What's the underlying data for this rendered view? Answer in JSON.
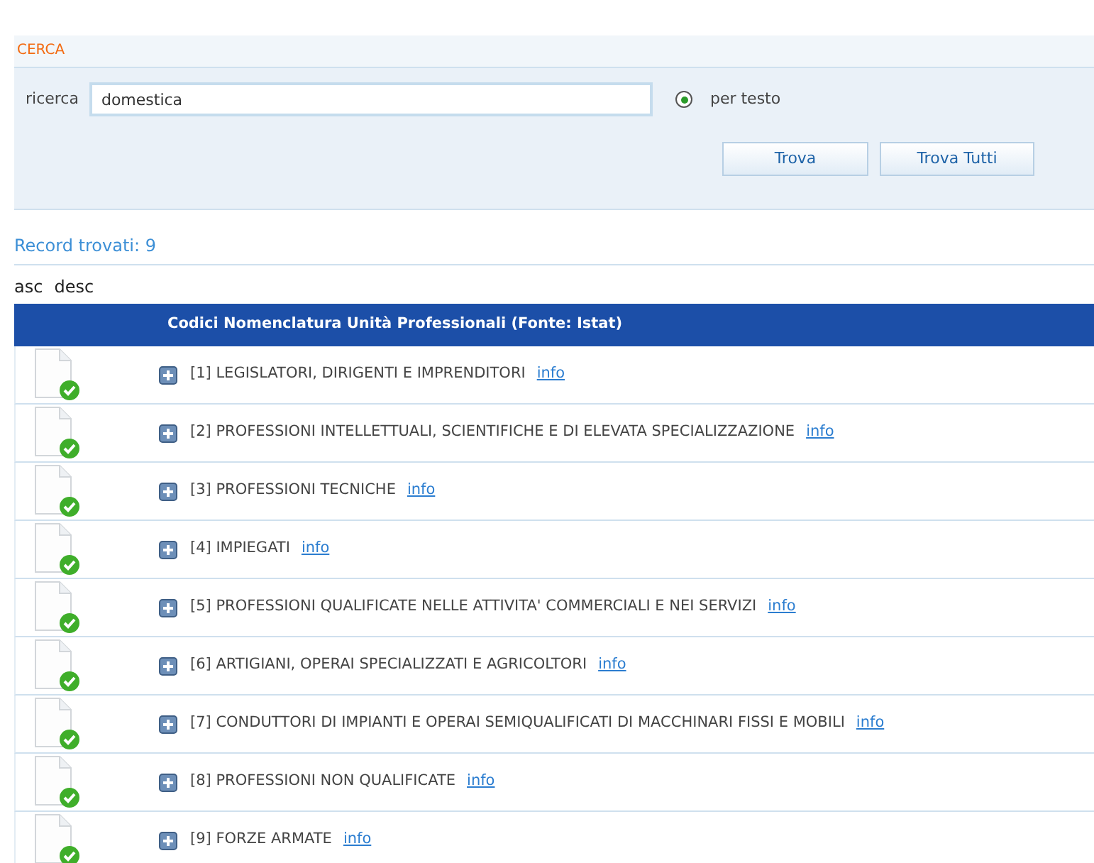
{
  "search_panel": {
    "title": "CERCA",
    "field_label": "ricerca",
    "query": "domestica",
    "modes": [
      {
        "label": "per testo",
        "selected": true
      }
    ],
    "buttons": [
      "Trova",
      "Trova Tutti"
    ]
  },
  "result_count": "Record trovati: 9",
  "sort_links": [
    "asc",
    "desc"
  ],
  "table": {
    "header": "Codici Nomenclatura Unità Professionali (Fonte: Istat)",
    "rows": [
      {
        "label": "[1] LEGISLATORI, DIRIGENTI E IMPRENDITORI",
        "link": "info"
      },
      {
        "label": "[2] PROFESSIONI INTELLETTUALI, SCIENTIFICHE E DI ELEVATA SPECIALIZZAZIONE",
        "link": "info"
      },
      {
        "label": "[3] PROFESSIONI TECNICHE",
        "link": "info"
      },
      {
        "label": "[4] IMPIEGATI",
        "link": "info"
      },
      {
        "label": "[5] PROFESSIONI QUALIFICATE NELLE ATTIVITA' COMMERCIALI E NEI SERVIZI",
        "link": "info"
      },
      {
        "label": "[6] ARTIGIANI, OPERAI SPECIALIZZATI E AGRICOLTORI",
        "link": "info"
      },
      {
        "label": "[7] CONDUTTORI DI IMPIANTI E OPERAI SEMIQUALIFICATI DI MACCHINARI FISSI E MOBILI",
        "link": "info"
      },
      {
        "label": "[8] PROFESSIONI NON QUALIFICATE",
        "link": "info"
      },
      {
        "label": "[9] FORZE ARMATE",
        "link": "info"
      }
    ]
  }
}
